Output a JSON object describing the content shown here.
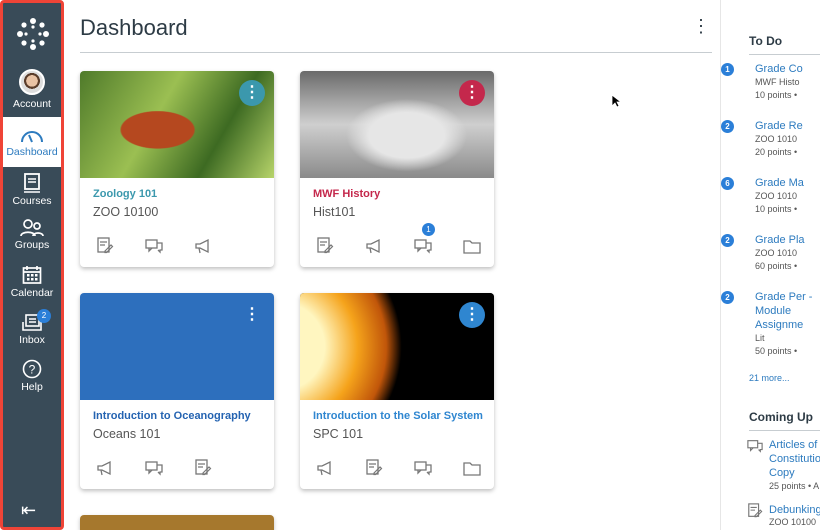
{
  "nav": {
    "items": [
      {
        "label": "Account",
        "icon": "avatar"
      },
      {
        "label": "Dashboard",
        "icon": "dashboard-icon",
        "active": true
      },
      {
        "label": "Courses",
        "icon": "courses-icon"
      },
      {
        "label": "Groups",
        "icon": "groups-icon"
      },
      {
        "label": "Calendar",
        "icon": "calendar-icon"
      },
      {
        "label": "Inbox",
        "icon": "inbox-icon",
        "badge": "2"
      },
      {
        "label": "Help",
        "icon": "help-icon"
      }
    ],
    "border_color": "#ef4437"
  },
  "header": {
    "title": "Dashboard"
  },
  "cards": [
    {
      "title": "Zoology 101",
      "code": "ZOO 10100",
      "color": "#3b98ad",
      "icons": [
        "assignments",
        "discussions",
        "announcements"
      ],
      "badges": {}
    },
    {
      "title": "MWF History",
      "code": "Hist101",
      "color": "#c4284c",
      "icons": [
        "assignments",
        "announcements",
        "discussions",
        "files"
      ],
      "badges": {
        "2": "1"
      }
    },
    {
      "title": "Introduction to Oceanography",
      "code": "Oceans 101",
      "color": "#2463b1",
      "icons": [
        "announcements",
        "discussions",
        "assignments"
      ],
      "badges": {}
    },
    {
      "title": "Introduction to the Solar System",
      "code": "SPC 101",
      "color": "#2f86d0",
      "icons": [
        "announcements",
        "assignments",
        "discussions",
        "files"
      ],
      "badges": {}
    }
  ],
  "todo": {
    "heading": "To Do",
    "items": [
      {
        "count": "1",
        "title": "Grade Co",
        "sub": "MWF Histo",
        "meta": "10 points •"
      },
      {
        "count": "2",
        "title": "Grade Re",
        "sub": "ZOO 1010",
        "meta": "20 points •"
      },
      {
        "count": "6",
        "title": "Grade Ma",
        "sub": "ZOO 1010",
        "meta": "10 points •"
      },
      {
        "count": "2",
        "title": "Grade Pla",
        "sub": "ZOO 1010",
        "meta": "60 points •"
      },
      {
        "count": "2",
        "title": "Grade Per - Module Assignme",
        "sub": "Lit",
        "meta": "50 points •"
      }
    ],
    "more": "21 more..."
  },
  "coming_up": {
    "heading": "Coming Up",
    "items": [
      {
        "icon": "discussion",
        "title": "Articles of C Constitutio Copy",
        "meta": "25 points • A"
      },
      {
        "icon": "assignment",
        "title": "Debunking",
        "meta": "ZOO 10100"
      }
    ]
  }
}
